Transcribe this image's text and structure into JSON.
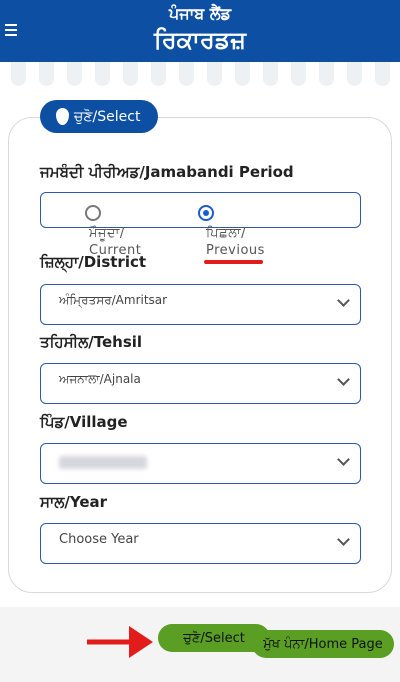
{
  "header": {
    "title_line1": "ਪੰਜਾਬ ਲੈਂਡ",
    "title_line2": "ਰਿਕਾਰਡਜ਼",
    "menu_icon": "hamburger-icon"
  },
  "select_pill": {
    "label": "ਚੁਣੋ/Select",
    "icon": "map-pin-icon"
  },
  "form": {
    "period": {
      "label": "ਜਮਬੰਦੀ ਪੀਰੀਅਡ/Jamabandi Period",
      "options": [
        {
          "line1": "ਮੌਜੂਦਾ/",
          "line2": "Current",
          "checked": false
        },
        {
          "line1": "ਪਿਛਲਾ/",
          "line2": "Previous",
          "checked": true
        }
      ]
    },
    "district": {
      "label": "ਜ਼ਿਲ੍ਹਾ/District",
      "value": "ਅੰਮ੍ਰਿਤਸਰ/Amritsar"
    },
    "tehsil": {
      "label": "ਤਹਿਸੀਲ/Tehsil",
      "value": "ਅਜਨਾਲਾ/Ajnala"
    },
    "village": {
      "label": "ਪਿੰਡ/Village",
      "value": ""
    },
    "year": {
      "label": "ਸਾਲ/Year",
      "value": "Choose Year"
    }
  },
  "footer": {
    "select_button": "ਚੁਣੋ/Select",
    "home_button": "ਮੁੱਖ ਪੰਨਾ/Home Page"
  },
  "colors": {
    "brand_blue": "#0d4fa3",
    "button_green": "#5a9e24",
    "annotation_red": "#e21b1b"
  }
}
